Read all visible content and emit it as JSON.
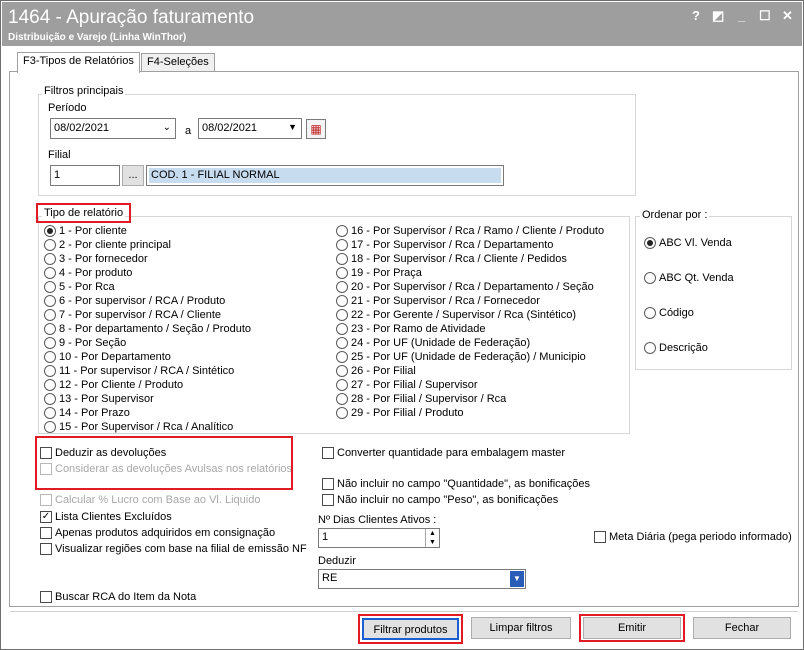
{
  "window": {
    "title": "1464 - Apuração faturamento",
    "subtitle": "Distribuição e Varejo (Linha WinThor)",
    "controls": [
      "?",
      "◩",
      "_",
      "☐",
      "✕"
    ]
  },
  "tabs": [
    {
      "label": "F3-Tipos de Relatórios"
    },
    {
      "label": "F4-Seleções"
    }
  ],
  "filtros": {
    "group_label": "Filtros principais",
    "periodo_label": "Período",
    "date_from": "08/02/2021",
    "date_sep": "a",
    "date_to": "08/02/2021",
    "filial_label": "Filial",
    "filial_code": "1",
    "filial_button": "...",
    "filial_desc": "COD. 1 - FILIAL NORMAL"
  },
  "tipo": {
    "label": "Tipo de relatório",
    "col1": [
      "1 - Por cliente",
      "2 - Por cliente principal",
      "3 - Por fornecedor",
      "4 - Por produto",
      "5 - Por Rca",
      "6 - Por supervisor / RCA / Produto",
      "7 - Por supervisor / RCA / Cliente",
      "8 - Por departamento / Seção / Produto",
      "9 - Por Seção",
      "10 - Por Departamento",
      "11 - Por supervisor / RCA / Sintético",
      "12 - Por Cliente / Produto",
      "13 - Por Supervisor",
      "14 - Por Prazo",
      "15 - Por Supervisor / Rca / Analítico"
    ],
    "col2": [
      "16 - Por Supervisor / Rca / Ramo /  Cliente / Produto",
      "17 - Por Supervisor / Rca / Departamento",
      "18 - Por Supervisor / Rca / Cliente / Pedidos",
      "19 - Por Praça",
      "20 - Por Supervisor / Rca / Departamento / Seção",
      "21 - Por Supervisor / Rca / Fornecedor",
      "22 - Por Gerente / Supervisor / Rca (Sintético)",
      "23 - Por Ramo de Atividade",
      "24 - Por UF (Unidade de Federação)",
      "25 - Por UF (Unidade de Federação) / Municipio",
      "26 - Por Filial",
      "27 - Por Filial / Supervisor",
      "28 - Por Filial / Supervisor / Rca",
      "29 - Por Filial / Produto"
    ],
    "selected": "1 - Por cliente"
  },
  "ordenar": {
    "label": "Ordenar por :",
    "options": [
      "ABC Vl. Venda",
      "ABC Qt. Venda",
      "Código",
      "Descrição"
    ],
    "selected": "ABC Vl. Venda"
  },
  "options": {
    "deduzir_devolucoes": "Deduzir as devoluções",
    "considerar_avulsas": "Considerar as devoluções Avulsas nos relatórios",
    "calcular_lucro": "Calcular % Lucro com Base ao Vl. Liquido",
    "lista_excluidos": "Lista Clientes Excluídos",
    "apenas_consignacao": "Apenas produtos adquiridos em consignação",
    "visualizar_regioes": "Visualizar regiões com base na filial de emissão NF",
    "buscar_rca": "Buscar RCA do Item da Nota",
    "converter_qtd": "Converter quantidade para embalagem master",
    "nao_incluir_qtd": "Não incluir no campo \"Quantidade\", as bonificações",
    "nao_incluir_peso": "Não incluir no campo \"Peso\", as bonificações",
    "dias_label": "Nº Dias Clientes Ativos :",
    "dias_value": "1",
    "meta_diaria": "Meta Diária (pega periodo informado)",
    "deduzir_label": "Deduzir",
    "deduzir_value": "RE",
    "lista_excluidos_checked": true
  },
  "buttons": {
    "filtrar": "Filtrar produtos",
    "limpar": "Limpar filtros",
    "emitir": "Emitir",
    "fechar": "Fechar"
  },
  "colors": {
    "titlebar": "#9e9e9e",
    "highlight_red": "#e01b24",
    "focus_blue": "#1c5fd0",
    "selected_field": "#c7dcef"
  }
}
